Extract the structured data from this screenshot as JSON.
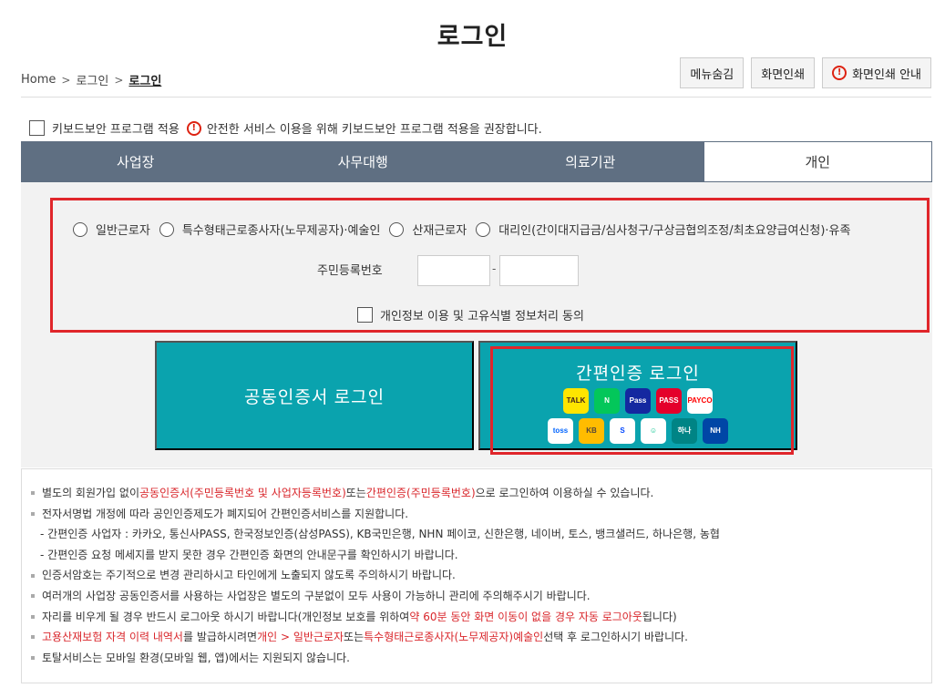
{
  "page": {
    "title": "로그인"
  },
  "breadcrumb": {
    "home": "Home",
    "level1": "로그인",
    "current": "로그인",
    "separator": ">"
  },
  "top_buttons": {
    "hide_menu": "메뉴숨김",
    "print": "화면인쇄",
    "print_info": "화면인쇄 안내"
  },
  "keyboard": {
    "label": "키보드보안 프로그램 적용",
    "notice": "안전한 서비스 이용을 위해 키보드보안 프로그램 적용을 권장합니다."
  },
  "tabs": [
    {
      "label": "사업장",
      "active": false
    },
    {
      "label": "사무대행",
      "active": false
    },
    {
      "label": "의료기관",
      "active": false
    },
    {
      "label": "개인",
      "active": true
    }
  ],
  "user_types": [
    "일반근로자",
    "특수형태근로종사자(노무제공자)·예술인",
    "산재근로자",
    "대리인(간이대지급금/심사청구/구상금협의조정/최초요양급여신청)·유족"
  ],
  "resident": {
    "label": "주민등록번호",
    "separator": "-"
  },
  "consent": {
    "label": "개인정보 이용 및 고유식별 정보처리 동의"
  },
  "buttons": {
    "cert_login": "공동인증서 로그인",
    "easy_login": "간편인증 로그인"
  },
  "easy_logos": {
    "row1": [
      {
        "name": "kakao-talk-icon",
        "text": "TALK",
        "bg": "#fee500",
        "color": "#3c1e1e"
      },
      {
        "name": "naver-icon",
        "text": "N",
        "bg": "#03c75a",
        "color": "#ffffff"
      },
      {
        "name": "samsung-pass-icon",
        "text": "Pass",
        "bg": "#1428a0",
        "color": "#ffffff"
      },
      {
        "name": "pass-icon",
        "text": "PASS",
        "bg": "#e4002b",
        "color": "#ffffff"
      },
      {
        "name": "payco-icon",
        "text": "PAYCO",
        "bg": "#ffffff",
        "color": "#ff0000"
      }
    ],
    "row2": [
      {
        "name": "toss-icon",
        "text": "toss",
        "bg": "#ffffff",
        "color": "#0064ff"
      },
      {
        "name": "kb-bank-icon",
        "text": "KB",
        "bg": "#ffbc00",
        "color": "#54463a"
      },
      {
        "name": "shinhan-bank-icon",
        "text": "S",
        "bg": "#ffffff",
        "color": "#0046ff"
      },
      {
        "name": "bank-salad-icon",
        "text": "☺",
        "bg": "#ffffff",
        "color": "#00c28c"
      },
      {
        "name": "hana-bank-icon",
        "text": "하나",
        "bg": "#008485",
        "color": "#ffffff"
      },
      {
        "name": "nh-bank-icon",
        "text": "NH",
        "bg": "#0046a6",
        "color": "#ffffff"
      }
    ]
  },
  "notices": {
    "n1": {
      "a": "별도의 회원가입 없이 ",
      "b": "공동인증서(주민등록번호 및 사업자등록번호)",
      "c": " 또는 ",
      "d": "간편인증(주민등록번호)",
      "e": "으로 로그인하여 이용하실 수 있습니다."
    },
    "n2": "전자서명법 개정에 따라 공인인증제도가 폐지되어 간편인증서비스를 지원합니다.",
    "n2a": "- 간편인증 사업자 : 카카오, 통신사PASS, 한국정보인증(삼성PASS), KB국민은행, NHN 페이코, 신한은행, 네이버, 토스, 뱅크샐러드, 하나은행, 농협",
    "n2b": "- 간편인증 요청 메세지를 받지 못한 경우 간편인증 화면의 안내문구를 확인하시기 바랍니다.",
    "n3": "인증서암호는 주기적으로 변경 관리하시고 타인에게 노출되지 않도록 주의하시기 바랍니다.",
    "n4": "여러개의 사업장 공동인증서를 사용하는 사업장은 별도의 구분없이 모두 사용이 가능하니 관리에 주의해주시기 바랍니다.",
    "n5": {
      "a": "자리를 비우게 될 경우 반드시 로그아웃 하시기 바랍니다(개인정보 보호를 위하여 ",
      "b": "약 60분 동안 화면 이동이 없을 경우 자동 로그아웃",
      "c": "됩니다)"
    },
    "n6": {
      "a": "고용산재보험 자격 이력 내역서",
      "b": "를 발급하시려면 ",
      "c": "개인 > 일반근로자",
      "d": " 또는 ",
      "e": "특수형태근로종사자(노무제공자)예술인",
      "f": " 선택 후 로그인하시기 바랍니다."
    },
    "n7": "토탈서비스는 모바일 환경(모바일 웹, 앱)에서는 지원되지 않습니다."
  }
}
